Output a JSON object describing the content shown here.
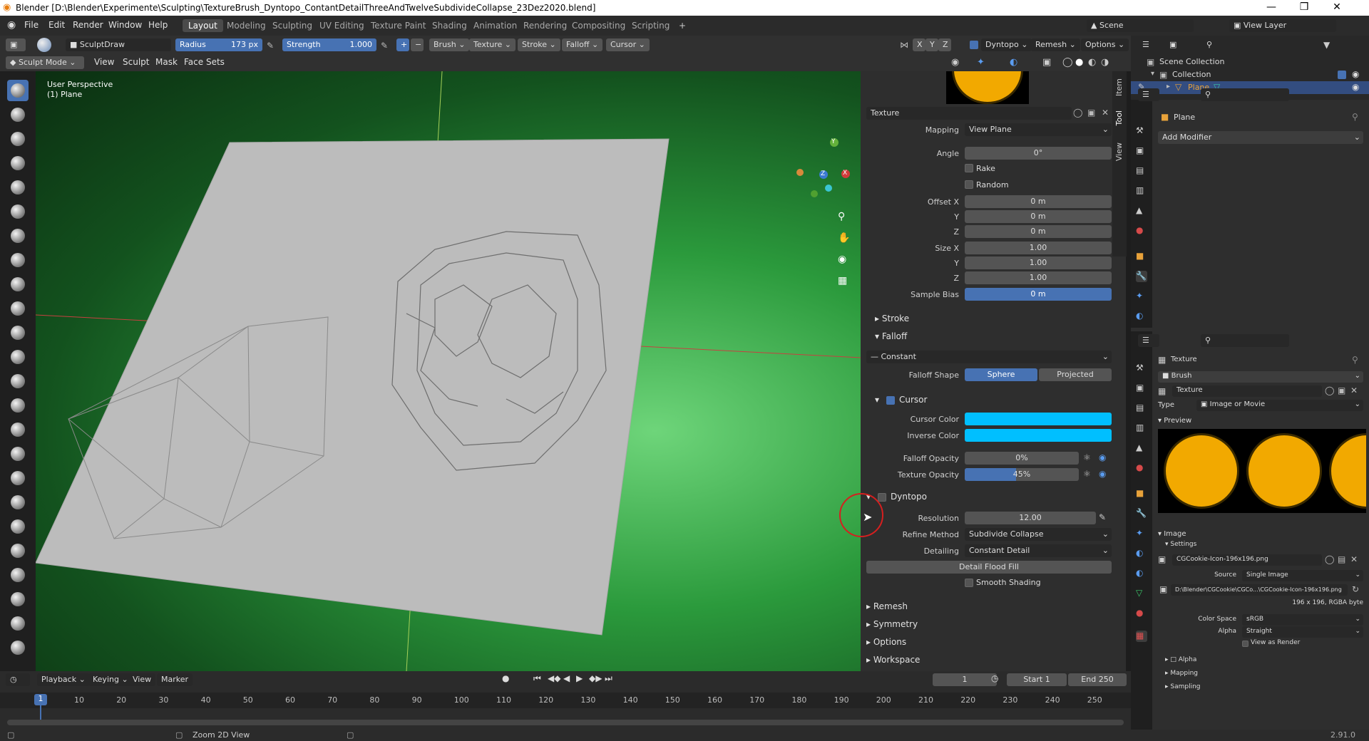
{
  "window": {
    "title": "Blender [D:\\Blender\\Experimente\\Sculpting\\TextureBrush_Dyntopo_ContantDetailThreeAndTwelveSubdivideCollapse_23Dez2020.blend]",
    "minimize": "—",
    "maximize": "❒",
    "close": "✕"
  },
  "menu": [
    "File",
    "Edit",
    "Render",
    "Window",
    "Help"
  ],
  "workspaces": [
    "Layout",
    "Modeling",
    "Sculpting",
    "UV Editing",
    "Texture Paint",
    "Shading",
    "Animation",
    "Rendering",
    "Compositing",
    "Scripting"
  ],
  "scene": {
    "name": "Scene",
    "view_layer": "View Layer"
  },
  "tool_header": {
    "brush_name": "SculptDraw",
    "radius_label": "Radius",
    "radius_value": "173 px",
    "strength_label": "Strength",
    "strength_value": "1.000",
    "menus": [
      "Brush",
      "Texture",
      "Stroke",
      "Falloff",
      "Cursor"
    ],
    "axis": [
      "X",
      "Y",
      "Z"
    ],
    "dyntopo": "Dyntopo",
    "remesh": "Remesh",
    "options": "Options"
  },
  "viewport_header": {
    "mode": "Sculpt Mode",
    "menus": [
      "View",
      "Sculpt",
      "Mask",
      "Face Sets"
    ]
  },
  "viewport": {
    "perspective": "User Perspective",
    "object": "(1) Plane",
    "gizmo": {
      "x": "X",
      "y": "Y",
      "z": "Z"
    }
  },
  "side_tabs": [
    "Item",
    "Tool",
    "View"
  ],
  "texture_panel": {
    "texture_name": "Texture",
    "mapping_label": "Mapping",
    "mapping_value": "View Plane",
    "angle_label": "Angle",
    "angle_value": "0°",
    "rake": "Rake",
    "random": "Random",
    "offset_x_label": "Offset X",
    "offset_x": "0 m",
    "offset_y_label": "Y",
    "offset_y": "0 m",
    "offset_z_label": "Z",
    "offset_z": "0 m",
    "size_x_label": "Size X",
    "size_x": "1.00",
    "size_y_label": "Y",
    "size_y": "1.00",
    "size_z_label": "Z",
    "size_z": "1.00",
    "sample_bias_label": "Sample Bias",
    "sample_bias": "0 m"
  },
  "stroke": "Stroke",
  "falloff": {
    "title": "Falloff",
    "preset": "Constant",
    "shape_label": "Falloff Shape",
    "sphere": "Sphere",
    "projected": "Projected"
  },
  "cursor": {
    "title": "Cursor",
    "cursor_color_label": "Cursor Color",
    "inverse_color_label": "Inverse Color",
    "falloff_opacity_label": "Falloff Opacity",
    "falloff_opacity": "0%",
    "texture_opacity_label": "Texture Opacity",
    "texture_opacity": "45%",
    "texture_opacity_fraction": 0.45,
    "color": "#00bfff"
  },
  "dyntopo": {
    "title": "Dyntopo",
    "resolution_label": "Resolution",
    "resolution": "12.00",
    "refine_label": "Refine Method",
    "refine": "Subdivide Collapse",
    "detailing_label": "Detailing",
    "detailing": "Constant Detail",
    "flood_fill": "Detail Flood Fill",
    "smooth_shading": "Smooth Shading"
  },
  "collapsed_sections": [
    "Remesh",
    "Symmetry",
    "Options",
    "Workspace"
  ],
  "outliner": {
    "scene_collection": "Scene Collection",
    "collection": "Collection",
    "plane": "Plane"
  },
  "modifier_panel": {
    "object": "Plane",
    "add_modifier": "Add Modifier"
  },
  "texture_props": {
    "header": "Texture",
    "brush": "Brush",
    "texture_name": "Texture",
    "type_label": "Type",
    "type_value": "Image or Movie",
    "preview": "Preview",
    "image": "Image",
    "settings": "Settings",
    "image_file": "CGCookie-Icon-196x196.png",
    "source_label": "Source",
    "source_value": "Single Image",
    "filepath": "D:\\Blender\\CGCookie\\CGCo...\\CGCookie-Icon-196x196.png",
    "resolution_info": "196 x 196,  RGBA byte",
    "color_space_label": "Color Space",
    "color_space": "sRGB",
    "alpha_label": "Alpha",
    "alpha_value": "Straight",
    "view_as_render": "View as Render",
    "sub_sections": [
      "Alpha",
      "Mapping",
      "Sampling"
    ]
  },
  "timeline": {
    "menus": [
      "Playback",
      "Keying",
      "View",
      "Marker"
    ],
    "current_frame": "1",
    "start_label": "Start",
    "start": "1",
    "end_label": "End",
    "end": "250",
    "marker_frame": "1",
    "frames": [
      "10",
      "20",
      "30",
      "40",
      "50",
      "60",
      "70",
      "80",
      "90",
      "100",
      "110",
      "120",
      "130",
      "140",
      "150",
      "160",
      "170",
      "180",
      "190",
      "200",
      "210",
      "220",
      "230",
      "240",
      "250"
    ]
  },
  "status": {
    "hint": "Zoom 2D View",
    "version": "2.91.0"
  }
}
